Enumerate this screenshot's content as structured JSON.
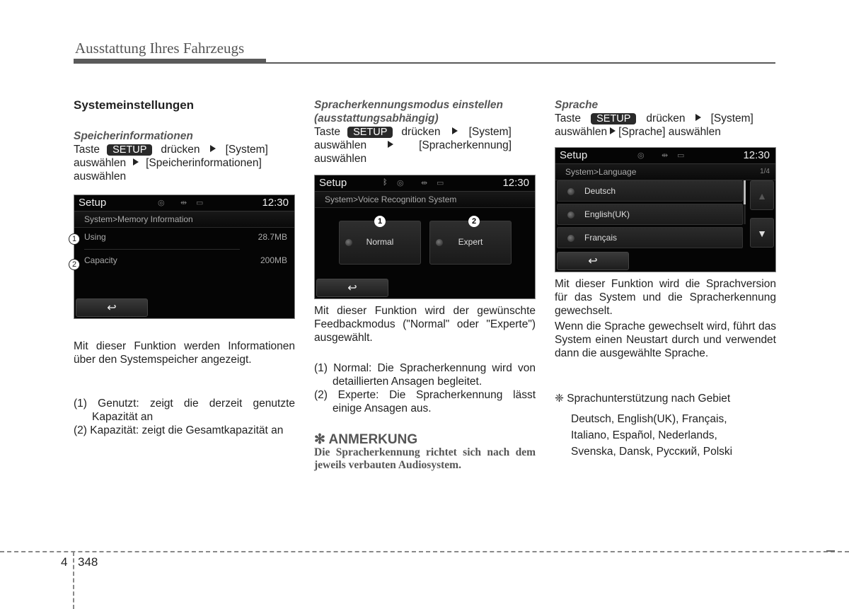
{
  "header": {
    "title": "Ausstattung Ihres Fahrzeugs"
  },
  "col1": {
    "heading": "Systemeinstellungen",
    "subheading": "Speicherinformationen",
    "instr": {
      "pre": "Taste",
      "key": "SETUP",
      "mid": "drücken",
      "step1": "[System]",
      "line2a": "auswählen",
      "step2": "[Speicherinformationen]",
      "line3": "auswählen"
    },
    "screen": {
      "title": "Setup",
      "time": "12:30",
      "icons": [
        "disc-icon",
        "usb-icon",
        "battery-icon"
      ],
      "breadcrumb": "System>Memory Information",
      "rows": [
        {
          "marker": "1",
          "label": "Using",
          "value": "28.7MB"
        },
        {
          "marker": "2",
          "label": "Capacity",
          "value": "200MB"
        }
      ],
      "back_label": "↩"
    },
    "desc": "Mit dieser Funktion werden Informationen über den Systemspeicher angezeigt.",
    "list": [
      "(1) Genutzt: zeigt die derzeit genutzte Kapazität an",
      "(2) Kapazität: zeigt die Gesamtkapazität an"
    ]
  },
  "col2": {
    "subheading": "Spracherkennungsmodus einstellen (ausstattungsabhängig)",
    "instr": {
      "pre": "Taste",
      "key": "SETUP",
      "mid": "drücken",
      "step1": "[System]",
      "line2a": "auswählen",
      "step2": "[Spracherkennung]",
      "line3": "auswählen"
    },
    "screen": {
      "title": "Setup",
      "time": "12:30",
      "icons": [
        "bluetooth-icon",
        "disc-icon",
        "usb-icon",
        "battery-icon"
      ],
      "breadcrumb": "System>Voice Recognition System",
      "modes": [
        {
          "marker": "1",
          "label": "Normal"
        },
        {
          "marker": "2",
          "label": "Expert"
        }
      ],
      "back_label": "↩"
    },
    "desc": "Mit dieser Funktion wird der gewünschte Feedbackmodus (\"Normal\" oder \"Experte\") ausgewählt.",
    "list": [
      "(1) Normal: Die Spracherkennung wird von detaillierten Ansagen begleitet.",
      "(2) Experte: Die Spracherkennung lässt einige Ansagen aus."
    ],
    "note": {
      "symbol": "✻",
      "title": "ANMERKUNG",
      "body": "Die Spracherkennung richtet sich nach dem jeweils verbauten Audiosystem."
    }
  },
  "col3": {
    "subheading": "Sprache",
    "instr": {
      "pre": "Taste",
      "key": "SETUP",
      "mid": "drücken",
      "step1": "[System]",
      "line2a": "auswählen",
      "step2": "[Sprache] auswählen"
    },
    "screen": {
      "title": "Setup",
      "time": "12:30",
      "icons": [
        "disc-icon",
        "usb-icon",
        "battery-icon"
      ],
      "breadcrumb": "System>Language",
      "page": "1/4",
      "languages": [
        "Deutsch",
        "English(UK)",
        "Français"
      ],
      "up": "▲",
      "down": "▼",
      "back_label": "↩"
    },
    "desc1": "Mit dieser Funktion wird die Sprachversion für das System und die Spracherkennung gewechselt.",
    "desc2": "Wenn die Sprache gewechselt wird, führt das System einen Neustart durch und verwendet dann die ausgewählte Sprache.",
    "support_title": "❈ Sprachunterstützung nach Gebiet",
    "support_lines": [
      "Deutsch, English(UK), Français,",
      "Italiano, Español, Nederlands,",
      "Svenska, Dansk, Русский, Polski"
    ]
  },
  "footer": {
    "chapter": "4",
    "page": "348"
  }
}
